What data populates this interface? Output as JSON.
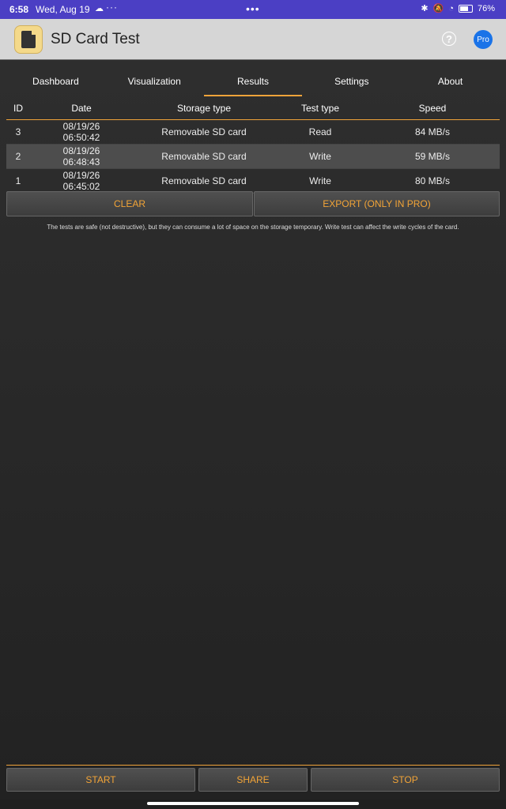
{
  "status": {
    "time": "6:58",
    "date": "Wed, Aug 19",
    "battery": "76%"
  },
  "app": {
    "title": "SD Card Test",
    "pro": "Pro"
  },
  "tabs": [
    "Dashboard",
    "Visualization",
    "Results",
    "Settings",
    "About"
  ],
  "table": {
    "headers": [
      "ID",
      "Date",
      "Storage type",
      "Test type",
      "Speed"
    ],
    "rows": [
      {
        "id": "3",
        "date1": "08/19/26",
        "date2": "06:50:42",
        "storage": "Removable SD card",
        "test": "Read",
        "speed": "84 MB/s"
      },
      {
        "id": "2",
        "date1": "08/19/26",
        "date2": "06:48:43",
        "storage": "Removable SD card",
        "test": "Write",
        "speed": "59 MB/s"
      },
      {
        "id": "1",
        "date1": "08/19/26",
        "date2": "06:45:02",
        "storage": "Removable SD card",
        "test": "Write",
        "speed": "80 MB/s"
      }
    ]
  },
  "buttons": {
    "clear": "CLEAR",
    "export": "EXPORT (ONLY IN PRO)",
    "start": "START",
    "share": "SHARE",
    "stop": "STOP"
  },
  "note": "The tests are safe (not destructive), but they can consume a lot of space on the storage temporary. Write test can affect the write cycles of the card."
}
